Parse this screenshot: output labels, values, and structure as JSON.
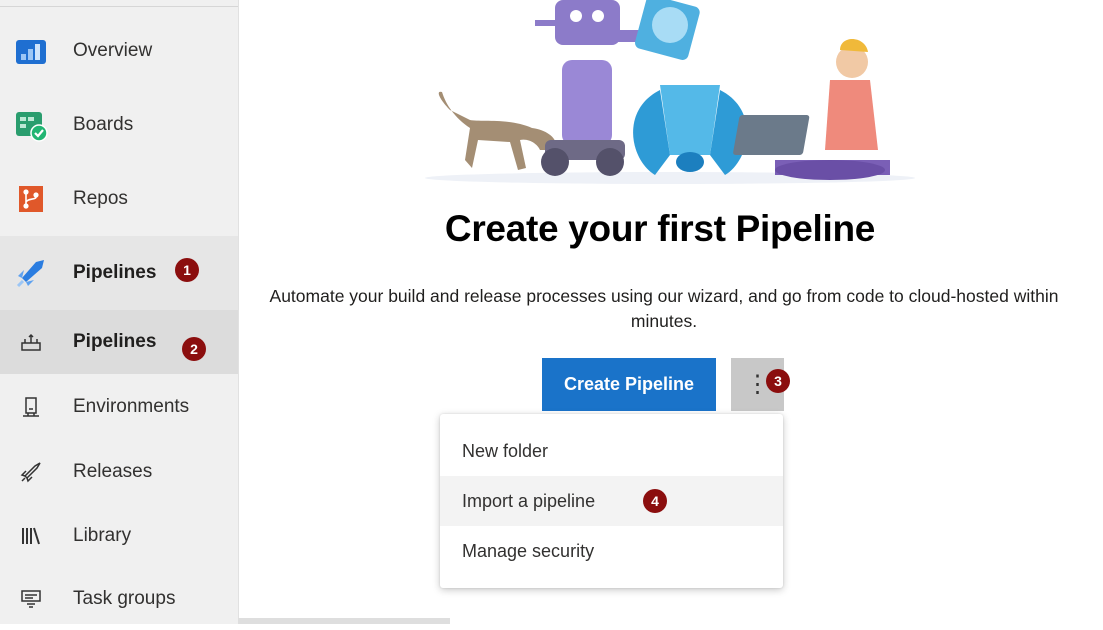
{
  "sidebar": {
    "items": [
      {
        "label": "Overview",
        "icon": "overview-icon"
      },
      {
        "label": "Boards",
        "icon": "boards-icon"
      },
      {
        "label": "Repos",
        "icon": "repos-icon"
      },
      {
        "label": "Pipelines",
        "icon": "pipelines-icon",
        "badge": "1"
      },
      {
        "label": "Pipelines",
        "icon": "pipelines-sub-icon",
        "badge": "2"
      },
      {
        "label": "Environments",
        "icon": "environments-icon"
      },
      {
        "label": "Releases",
        "icon": "releases-icon"
      },
      {
        "label": "Library",
        "icon": "library-icon"
      },
      {
        "label": "Task groups",
        "icon": "task-groups-icon"
      }
    ]
  },
  "main": {
    "title": "Create your first Pipeline",
    "description": "Automate your build and release processes using our wizard, and go from code to cloud-hosted within minutes.",
    "create_button": "Create Pipeline",
    "more_button": "⋮",
    "more_badge": "3"
  },
  "menu": {
    "items": [
      {
        "label": "New folder"
      },
      {
        "label": "Import a pipeline",
        "badge": "4"
      },
      {
        "label": "Manage security"
      }
    ]
  },
  "colors": {
    "accent": "#1a73c9",
    "badge": "#8b0e0e"
  }
}
